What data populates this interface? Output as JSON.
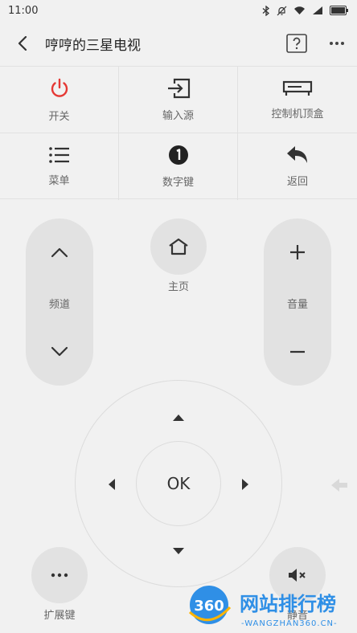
{
  "status": {
    "time": "11:00"
  },
  "header": {
    "title": "哼哼的三星电视"
  },
  "grid": [
    {
      "label": "开关",
      "icon": "power-icon",
      "color": "#e53935"
    },
    {
      "label": "输入源",
      "icon": "input-source-icon"
    },
    {
      "label": "控制机顶盒",
      "icon": "set-top-box-icon"
    },
    {
      "label": "菜单",
      "icon": "menu-list-icon"
    },
    {
      "label": "数字键",
      "icon": "number-keys-icon"
    },
    {
      "label": "返回",
      "icon": "return-icon"
    }
  ],
  "controls": {
    "channel": "频道",
    "home": "主页",
    "volume": "音量",
    "ok": "OK",
    "extend": "扩展键",
    "mute": "静音"
  },
  "watermark": {
    "text": "网站排行榜",
    "sub": "-WANGZHAN360.CN-",
    "badge": "360"
  }
}
